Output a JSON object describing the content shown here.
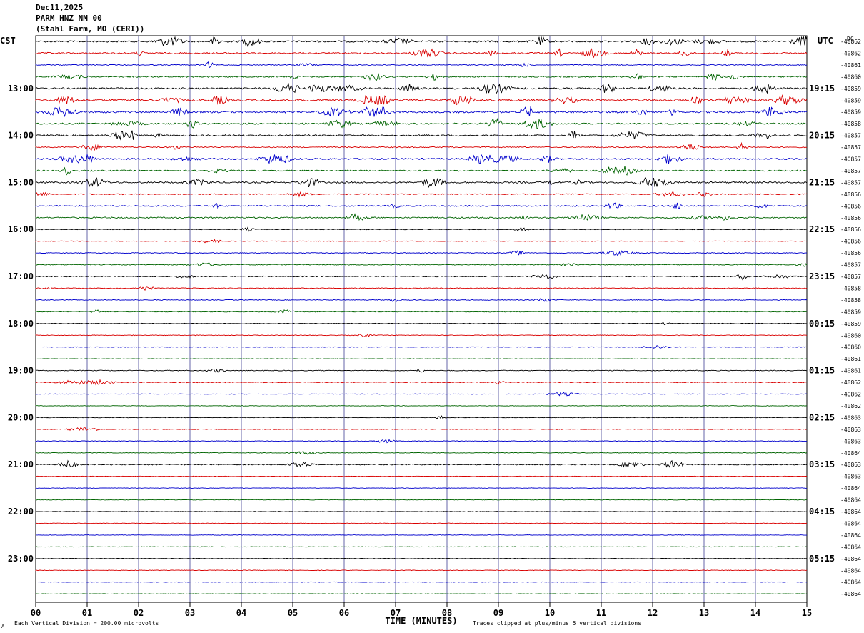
{
  "header": {
    "date": "Dec11,2025",
    "station": "PARM HNZ NM 00",
    "location": "(Stahl Farm, MO (CERI))"
  },
  "left_zone": "CST",
  "right_zone": "UTC",
  "dc_label": "DC",
  "footer": {
    "scale_note": "Each Vertical Division =  200.00 microvolts",
    "xlabel": "TIME (MINUTES)",
    "clip_note": "Traces clipped at plus/minus 5 vertical divisions",
    "corner_mark": "A"
  },
  "colors": {
    "trace_cycle": [
      "#000000",
      "#d90000",
      "#0000cc",
      "#006400"
    ],
    "gridline": "#6666aa",
    "axis": "#000000"
  },
  "chart_data": {
    "type": "line",
    "title": "PARM HNZ NM 00",
    "xlabel": "TIME (MINUTES)",
    "x_ticks": [
      "00",
      "01",
      "02",
      "03",
      "04",
      "05",
      "06",
      "07",
      "08",
      "09",
      "10",
      "11",
      "12",
      "13",
      "14",
      "15"
    ],
    "xlim": [
      0,
      15
    ],
    "rows_per_hour": 4,
    "left_hour_labels": [
      "13:00",
      "14:00",
      "15:00",
      "16:00",
      "17:00",
      "18:00",
      "19:00",
      "20:00",
      "21:00",
      "22:00",
      "23:00"
    ],
    "right_hour_labels": [
      "19:15",
      "20:15",
      "21:15",
      "22:15",
      "23:15",
      "00:15",
      "01:15",
      "02:15",
      "03:15",
      "04:15",
      "05:15"
    ],
    "dc_values": [
      "-40862",
      "-40862",
      "-40861",
      "-40860",
      "-40859",
      "-40859",
      "-40859",
      "-40858",
      "-40857",
      "-40857",
      "-40857",
      "-40857",
      "-40857",
      "-40856",
      "-40856",
      "-40856",
      "-40856",
      "-40856",
      "-40856",
      "-40857",
      "-40857",
      "-40858",
      "-40858",
      "-40859",
      "-40859",
      "-40860",
      "-40860",
      "-40861",
      "-40861",
      "-40862",
      "-40862",
      "-40862",
      "-40863",
      "-40863",
      "-40863",
      "-40864",
      "-40863",
      "-40863",
      "-40864",
      "-40864",
      "-40864",
      "-40864",
      "-40864",
      "-40864",
      "-40864",
      "-40864",
      "-40864",
      "-40864"
    ],
    "activity": [
      0.7,
      0.6,
      0.25,
      0.55,
      0.7,
      0.85,
      0.85,
      0.6,
      0.6,
      0.35,
      0.6,
      0.45,
      0.6,
      0.35,
      0.45,
      0.45,
      0.15,
      0.1,
      0.2,
      0.25,
      0.3,
      0.2,
      0.15,
      0.2,
      0.12,
      0.1,
      0.12,
      0.05,
      0.15,
      0.25,
      0.08,
      0.05,
      0.1,
      0.12,
      0.1,
      0.08,
      0.35,
      0.05,
      0.05,
      0.05,
      0.05,
      0.05,
      0.05,
      0.05,
      0.05,
      0.05,
      0.05,
      0.05
    ],
    "y_scale": "Each Vertical Division =  200.00 microvolts",
    "clip": "Traces clipped at plus/minus 5 vertical divisions"
  }
}
